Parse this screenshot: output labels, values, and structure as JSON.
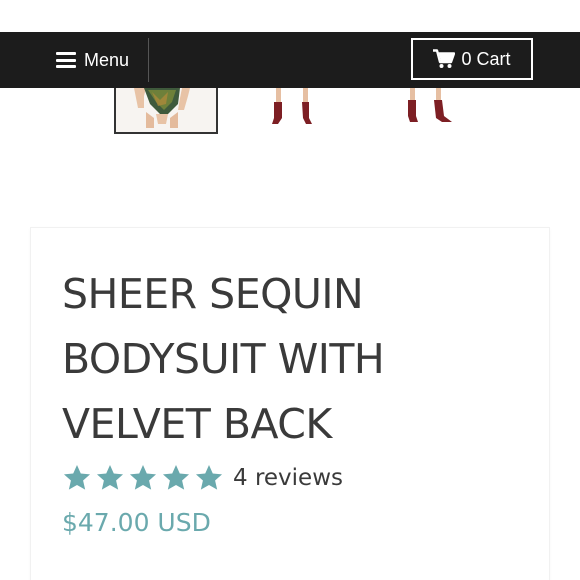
{
  "nav": {
    "menu_label": "Menu",
    "cart_label": "0 Cart"
  },
  "product": {
    "title": "SHEER SEQUIN BODYSUIT WITH VELVET BACK",
    "rating": 5,
    "rating_max": 5,
    "reviews_label": "4 reviews",
    "price": "$47.00 USD"
  },
  "colors": {
    "nav_background": "#1c1c1c",
    "star": "#6aa9ad",
    "price": "#6aa9ad",
    "text": "#3a3a3a"
  },
  "icons": {
    "menu": "hamburger-icon",
    "cart": "cart-icon",
    "rating": "star-icon"
  }
}
